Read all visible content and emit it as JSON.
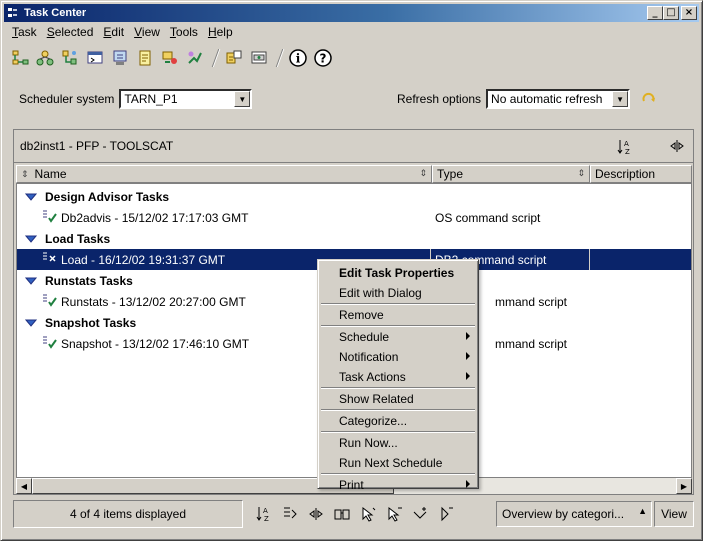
{
  "window": {
    "title": "Task Center",
    "controls": {
      "minimize": "_",
      "maximize": "□",
      "close": "×"
    }
  },
  "menubar": [
    {
      "label": "Task",
      "mnemonic": "T",
      "rest": "ask"
    },
    {
      "label": "Selected",
      "mnemonic": "S",
      "rest": "elected"
    },
    {
      "label": "Edit",
      "mnemonic": "E",
      "rest": "dit"
    },
    {
      "label": "View",
      "mnemonic": "V",
      "rest": "iew"
    },
    {
      "label": "Tools",
      "mnemonic": "T",
      "rest": "ools"
    },
    {
      "label": "Help",
      "mnemonic": "H",
      "rest": "elp"
    }
  ],
  "toolbar": {
    "icons": [
      "control-center-icon",
      "replication-center-icon",
      "satellite-admin-icon",
      "command-center-icon",
      "task-center-icon",
      "journal-icon",
      "license-center-icon",
      "development-center-icon",
      "contacts-icon",
      "tools-settings-icon",
      "info-icon",
      "help-icon"
    ],
    "info_glyph": "i",
    "help_glyph": "?"
  },
  "scheduler": {
    "label": "Scheduler system",
    "value": "TARN_P1"
  },
  "refresh": {
    "label": "Refresh options",
    "value": "No automatic refresh"
  },
  "panel": {
    "title": "db2inst1 - PFP - TOOLSCAT",
    "columns": [
      "Name",
      "Type",
      "Description"
    ]
  },
  "groups": [
    {
      "label": "Design Advisor Tasks",
      "items": [
        {
          "name": "Db2advis - 15/12/02 17:17:03 GMT",
          "type": "OS command script"
        }
      ]
    },
    {
      "label": "Load Tasks",
      "items": [
        {
          "name": "Load - 16/12/02 19:31:37 GMT",
          "type": "DB2 command script",
          "selected": true
        }
      ]
    },
    {
      "label": "Runstats Tasks",
      "items": [
        {
          "name": "Runstats - 13/12/02 20:27:00 GMT",
          "type": "mmand script"
        }
      ]
    },
    {
      "label": "Snapshot Tasks",
      "items": [
        {
          "name": "Snapshot - 13/12/02 17:46:10 GMT",
          "type": "mmand script"
        }
      ]
    }
  ],
  "context_menu": [
    {
      "label": "Edit Task Properties",
      "bold": true
    },
    {
      "label": "Edit with Dialog"
    },
    {
      "sep": true
    },
    {
      "label": "Remove"
    },
    {
      "sep": true
    },
    {
      "label": "Schedule",
      "submenu": true
    },
    {
      "label": "Notification",
      "submenu": true
    },
    {
      "label": "Task Actions",
      "submenu": true
    },
    {
      "sep": true
    },
    {
      "label": "Show Related"
    },
    {
      "sep": true
    },
    {
      "label": "Categorize..."
    },
    {
      "sep": true
    },
    {
      "label": "Run Now..."
    },
    {
      "label": "Run Next Schedule"
    },
    {
      "sep": true
    },
    {
      "label": "Print",
      "submenu": true
    }
  ],
  "status": {
    "count": "4 of 4 items displayed",
    "view_select": "Overview by categori...",
    "view_button": "View"
  },
  "colors": {
    "selection": "#0a246a",
    "window_bg": "#d4d0c8",
    "title_start": "#0a246a",
    "title_end": "#a6caf0"
  }
}
